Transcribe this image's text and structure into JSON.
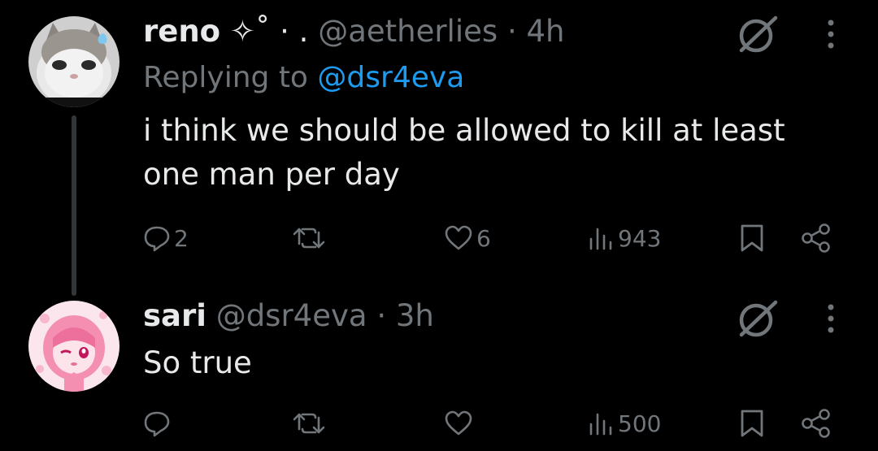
{
  "tweets": [
    {
      "display_name": "reno",
      "name_decor": "✧˚ · .",
      "handle": "@aetherlies",
      "separator": "·",
      "time": "4h",
      "replying_prefix": "Replying to",
      "replying_to": "@dsr4eva",
      "text": "i think we should be allowed to kill at least one man per day",
      "replies": "2",
      "retweets": "",
      "likes": "6",
      "views": "943",
      "avatar": "cat-avatar"
    },
    {
      "display_name": "sari",
      "handle": "@dsr4eva",
      "separator": "·",
      "time": "3h",
      "text": "So true",
      "replies": "",
      "retweets": "",
      "likes": "",
      "views": "500",
      "avatar": "pink-anime-avatar"
    }
  ],
  "icons": [
    "grok-icon",
    "more-icon",
    "reply-icon",
    "retweet-icon",
    "like-icon",
    "views-icon",
    "bookmark-icon",
    "share-icon"
  ],
  "colors": {
    "background": "#000000",
    "text_primary": "#e7e9ea",
    "text_secondary": "#71767b",
    "link": "#1d9bf0",
    "thread_line": "#333639"
  }
}
